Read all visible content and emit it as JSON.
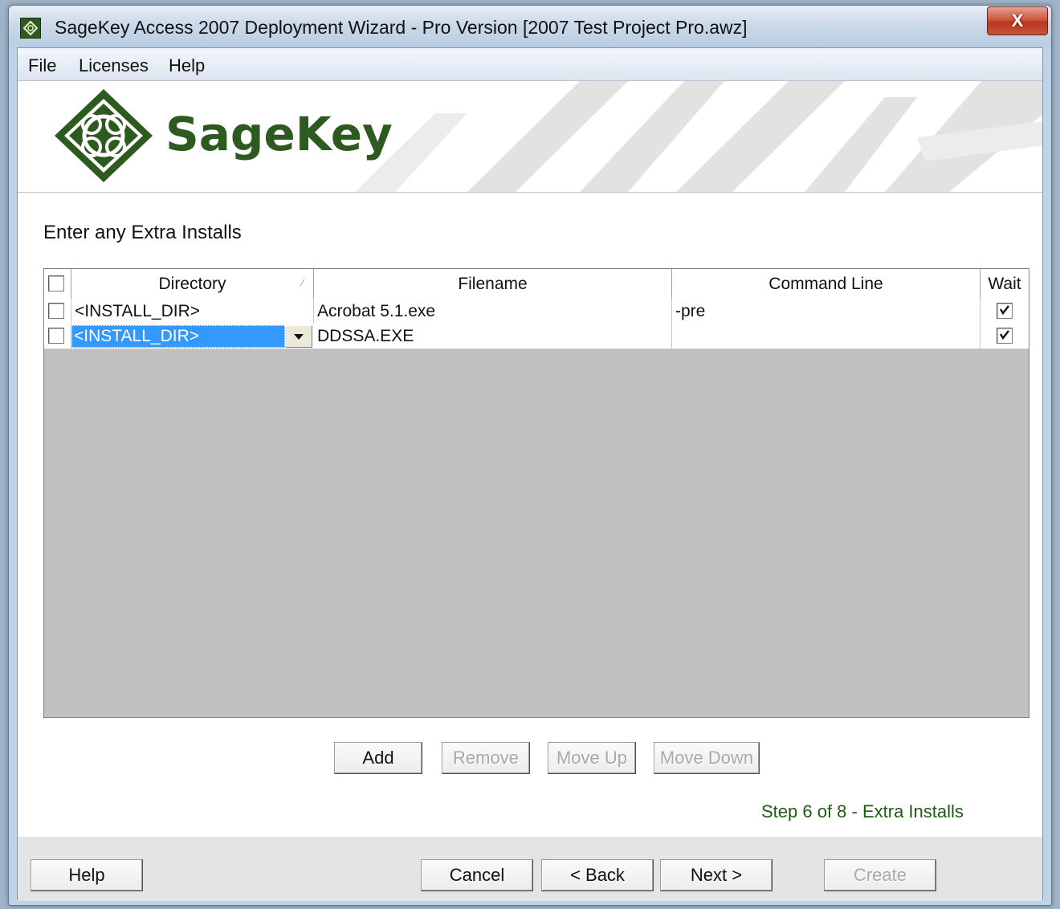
{
  "window": {
    "title": "SageKey Access 2007 Deployment Wizard - Pro Version [2007 Test Project Pro.awz]",
    "close_label": "X"
  },
  "menu": {
    "items": [
      {
        "label": "File"
      },
      {
        "label": "Licenses"
      },
      {
        "label": "Help"
      }
    ]
  },
  "banner": {
    "logo_text": "SageKey"
  },
  "page": {
    "heading": "Enter any Extra Installs",
    "step": "Step 6 of 8 - Extra Installs"
  },
  "grid": {
    "columns": [
      "Directory",
      "Filename",
      "Command Line",
      "Wait"
    ],
    "header_checked": false,
    "rows": [
      {
        "checked": false,
        "directory": "<INSTALL_DIR>",
        "filename": "Acrobat 5.1.exe",
        "command_line": "-pre",
        "wait": true
      },
      {
        "checked": false,
        "directory": "<INSTALL_DIR>",
        "filename": "DDSSA.EXE",
        "command_line": "",
        "wait": true,
        "selected": true
      }
    ]
  },
  "grid_buttons": {
    "add": "Add",
    "remove": "Remove",
    "move_up": "Move Up",
    "move_down": "Move Down"
  },
  "footer_buttons": {
    "help": "Help",
    "cancel": "Cancel",
    "back": "< Back",
    "next": "Next >",
    "create": "Create"
  },
  "colors": {
    "brand_green": "#2d5a1e",
    "step_text": "#1e5b12",
    "selection": "#3399ff",
    "grid_empty": "#c0c0c0"
  }
}
